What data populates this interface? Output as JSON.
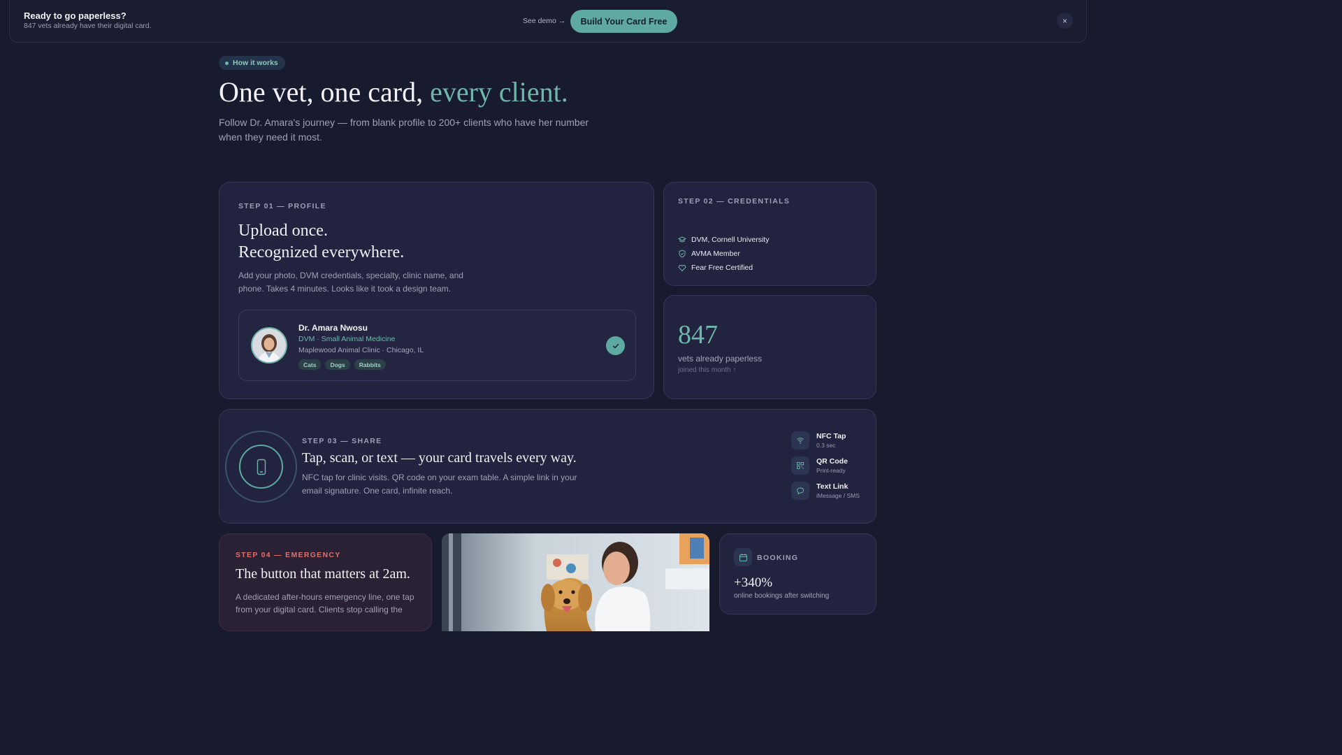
{
  "banner": {
    "title": "Ready to go paperless?",
    "subtitle": "847 vets already have their digital card.",
    "see_demo": "See demo →",
    "cta": "Build Your Card Free",
    "close": "×"
  },
  "hero": {
    "pill": "How it works",
    "title_main": "One vet, one card, ",
    "title_accent": "every client.",
    "subtitle": "Follow Dr. Amara's journey — from blank profile to 200+ clients who have her number when they need it most."
  },
  "step1": {
    "eyebrow": "STEP 01 — PROFILE",
    "title_line1": "Upload once.",
    "title_line2": "Recognized everywhere.",
    "desc": "Add your photo, DVM credentials, specialty, clinic name, and phone. Takes 4 minutes. Looks like it took a design team.",
    "profile": {
      "name": "Dr. Amara Nwosu",
      "specialty": "DVM · Small Animal Medicine",
      "clinic": "Maplewood Animal Clinic · Chicago, IL",
      "tags": [
        "Cats",
        "Dogs",
        "Rabbits"
      ]
    }
  },
  "step2": {
    "eyebrow": "STEP 02 — CREDENTIALS",
    "items": [
      {
        "label": "DVM, Cornell University",
        "icon": "graduation-cap-icon"
      },
      {
        "label": "AVMA Member",
        "icon": "shield-icon"
      },
      {
        "label": "Fear Free Certified",
        "icon": "heart-icon"
      }
    ]
  },
  "stat": {
    "number": "847",
    "label": "vets already paperless",
    "sub": "joined this month ↑"
  },
  "step3": {
    "eyebrow": "STEP 03 — SHARE",
    "title": "Tap, scan, or text — your card travels every way.",
    "desc": "NFC tap for clinic visits. QR code on your exam table. A simple link in your email signature. One card, infinite reach.",
    "methods": [
      {
        "title": "NFC Tap",
        "sub": "0.3 sec",
        "icon": "wifi-icon"
      },
      {
        "title": "QR Code",
        "sub": "Print-ready",
        "icon": "qr-code-icon"
      },
      {
        "title": "Text Link",
        "sub": "iMessage / SMS",
        "icon": "chat-bubble-icon"
      }
    ]
  },
  "step4": {
    "eyebrow": "STEP 04 — EMERGENCY",
    "title": "The button that matters at 2am.",
    "desc": "A dedicated after-hours emergency line, one tap from your digital card. Clients stop calling the"
  },
  "booking": {
    "eyebrow": "BOOKING",
    "number": "+340%",
    "sub": "online bookings after switching"
  },
  "colors": {
    "background": "#181a2e",
    "card": "#22233e",
    "accent": "#6fb7ad",
    "cta": "#5fa9a3",
    "emergency": "#e0706c"
  }
}
